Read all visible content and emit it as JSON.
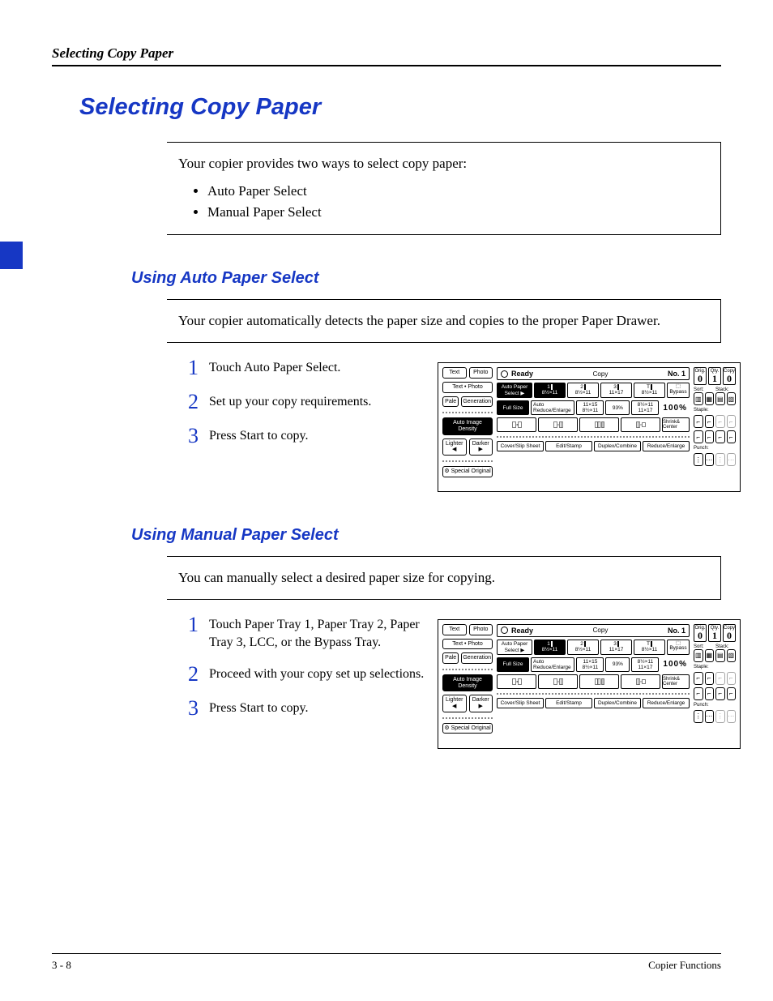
{
  "running_head": "Selecting Copy Paper",
  "page_title": "Selecting Copy Paper",
  "intro": {
    "text": "Your copier provides two ways to select copy paper:",
    "bullets": [
      "Auto Paper Select",
      "Manual Paper Select"
    ]
  },
  "section_auto": {
    "title": "Using Auto Paper Select",
    "intro": "Your copier automatically detects the paper size and copies to the proper Paper Drawer.",
    "steps": [
      "Touch Auto Paper Select.",
      "Set up your copy requirements.",
      "Press Start to copy."
    ]
  },
  "section_manual": {
    "title": "Using Manual Paper Select",
    "intro": "You can manually select a desired paper size for copying.",
    "steps": [
      "Touch Paper Tray 1, Paper Tray 2, Paper Tray 3, LCC, or the Bypass Tray.",
      "Proceed with your copy set up selections.",
      "Press Start to copy."
    ]
  },
  "panel": {
    "left": {
      "text": "Text",
      "photo": "Photo",
      "text_photo": "Text • Photo",
      "pale": "Pale",
      "generation": "Generation",
      "auto_density": "Auto Image Density",
      "lighter": "Lighter",
      "darker": "Darker",
      "special": "Special Original"
    },
    "status": {
      "ready": "Ready",
      "mode": "Copy",
      "job": "No. 1"
    },
    "auto_paper": "Auto Paper Select ▶",
    "trays": {
      "t1": {
        "num": "1",
        "size": "8½×11"
      },
      "t2": {
        "num": "2",
        "size": "8½×11"
      },
      "t3": {
        "num": "3",
        "size": "11×17"
      },
      "t4": {
        "num": "T",
        "size": "8½×11"
      },
      "bypass": "Bypass"
    },
    "scale": {
      "full": "Full Size",
      "auto": "Auto Reduce/Enlarge",
      "r1_top": "11×15",
      "r1_bot": "8½×11",
      "r1_pct": "93%",
      "r2_top": "8½×11",
      "r2_bot": "11×17",
      "pct100": "100%"
    },
    "finish": {
      "shrink": "Shrink& Center"
    },
    "bottom": {
      "cover": "Cover/Slip Sheet",
      "edit": "Edit/Stamp",
      "duplex": "Duplex/Combine",
      "reduce": "Reduce/Enlarge"
    },
    "right": {
      "orig": "Orig.",
      "qty": "Qty.",
      "copy": "Copy",
      "orig_v": "0",
      "qty_v": "1",
      "copy_v": "0",
      "sort": "Sort:",
      "stack": "Stack:",
      "staple": "Staple:",
      "punch": "Punch:"
    }
  },
  "footer": {
    "left": "3 - 8",
    "right": "Copier Functions"
  }
}
